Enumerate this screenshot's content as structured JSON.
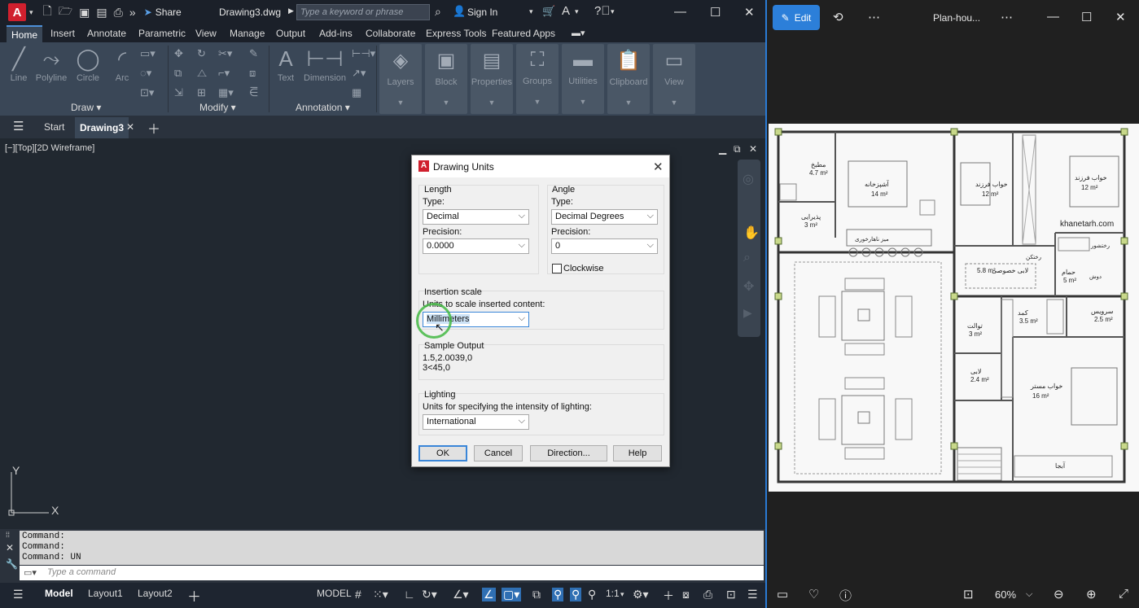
{
  "acad": {
    "logo": "A",
    "share_label": "Share",
    "doc_title": "Drawing3.dwg",
    "search_placeholder": "Type a keyword or phrase",
    "signin_label": "Sign In",
    "ribbon_tabs": [
      "Home",
      "Insert",
      "Annotate",
      "Parametric",
      "View",
      "Manage",
      "Output",
      "Add-ins",
      "Collaborate",
      "Express Tools",
      "Featured Apps"
    ],
    "draw_tools": [
      "Line",
      "Polyline",
      "Circle",
      "Arc"
    ],
    "annotation_tools": [
      "Text",
      "Dimension"
    ],
    "panel_labels": {
      "draw": "Draw ▾",
      "modify": "Modify ▾",
      "annotation": "Annotation ▾"
    },
    "group_buttons": [
      "Layers",
      "Block",
      "Properties",
      "Groups",
      "Utilities",
      "Clipboard",
      "View"
    ],
    "doc_tabs": {
      "start": "Start",
      "active": "Drawing3"
    },
    "viewport_label": "[−][Top][2D Wireframe]",
    "axis": {
      "y": "Y",
      "x": "X"
    },
    "command_history": [
      "Command:",
      "Command:",
      "Command: UN"
    ],
    "command_placeholder": "Type a command",
    "layout_tabs": [
      "Model",
      "Layout1",
      "Layout2"
    ],
    "status_model": "MODEL",
    "scale": "1:1"
  },
  "dialog": {
    "title": "Drawing Units",
    "length": {
      "heading": "Length",
      "type_label": "Type:",
      "type_value": "Decimal",
      "precision_label": "Precision:",
      "precision_value": "0.0000"
    },
    "angle": {
      "heading": "Angle",
      "type_label": "Type:",
      "type_value": "Decimal Degrees",
      "precision_label": "Precision:",
      "precision_value": "0",
      "clockwise_label": "Clockwise",
      "clockwise_checked": false
    },
    "insertion": {
      "heading": "Insertion scale",
      "label": "Units to scale inserted content:",
      "value": "Millimeters"
    },
    "sample": {
      "heading": "Sample Output",
      "line1": "1.5,2.0039,0",
      "line2": "3<45,0"
    },
    "lighting": {
      "heading": "Lighting",
      "label": "Units for specifying the intensity of lighting:",
      "value": "International"
    },
    "buttons": {
      "ok": "OK",
      "cancel": "Cancel",
      "direction": "Direction...",
      "help": "Help"
    }
  },
  "photos": {
    "edit_label": "Edit",
    "file_name": "Plan-hou...",
    "zoom": "60%",
    "plan_watermark": "khanetarh.com",
    "rooms": [
      {
        "name": "آشپزخانه",
        "area": "14 m²"
      },
      {
        "name": "خواب فرزند",
        "area": "12 m²"
      },
      {
        "name": "خواب فرزند",
        "area": "12 m²"
      },
      {
        "name": "مطبخ",
        "area": "4.7 m²"
      },
      {
        "name": "پذیرایی",
        "area": "3 m²"
      },
      {
        "name": "لابی خصوصی",
        "area": "5.8 m²"
      },
      {
        "name": "حمام",
        "area": "5 m²"
      },
      {
        "name": "سرویس",
        "area": "2.5 m²"
      },
      {
        "name": "کمد",
        "area": "3.5 m²"
      },
      {
        "name": "توالت",
        "area": "3 m²"
      },
      {
        "name": "لابی",
        "area": "2.4 m²"
      },
      {
        "name": "خواب مستر",
        "area": "16 m²"
      },
      {
        "name": "آبجا",
        "area": ""
      }
    ],
    "misc_labels": [
      "میز ناهارخوری",
      "رختکن",
      "دوش",
      "رختشور"
    ]
  },
  "colors": {
    "acad_bg": "#212830",
    "ribbon": "#3a4757",
    "accent_blue": "#2c7fd9",
    "cursor_ring": "#43b843",
    "logo_red": "#d0202e"
  }
}
